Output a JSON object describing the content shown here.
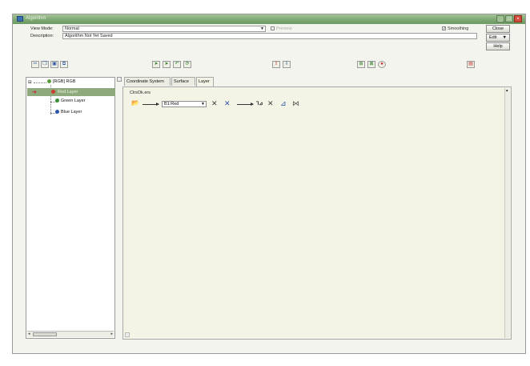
{
  "window": {
    "title": "Algorithm",
    "controls": [
      "_",
      "□",
      "×"
    ]
  },
  "view_mode": {
    "label": "View Mode:",
    "value": "Normal"
  },
  "description": {
    "label": "Description:",
    "value": "Algorithm Not Yet Saved"
  },
  "preview": {
    "label": "Preview",
    "checked": false
  },
  "smoothing": {
    "label": "Smoothing",
    "checked": true
  },
  "buttons": {
    "close": "Close",
    "edit": "Edit",
    "help": "Help"
  },
  "tree": {
    "root": "[RGB] RGB",
    "items": [
      "Red Layer",
      "Green Layer",
      "Blue Layer"
    ],
    "selected": "Red Layer"
  },
  "tabs": [
    "Coordinate System",
    "Surface",
    "Layer"
  ],
  "active_tab": "Layer",
  "layer_panel": {
    "file": "ClrsOk.ers",
    "band_dropdown": "B1:Red"
  },
  "colors": {
    "titlebar": "#7ea873",
    "selection": "#8ea97c",
    "panel_bg": "#f3f3e6"
  }
}
